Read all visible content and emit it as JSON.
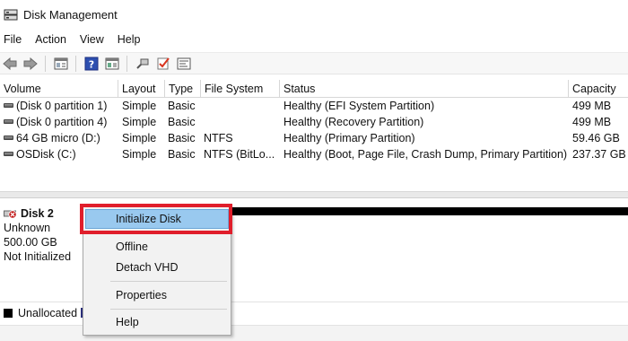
{
  "window": {
    "title": "Disk Management"
  },
  "menu": [
    "File",
    "Action",
    "View",
    "Help"
  ],
  "toolbar": {
    "buttons": [
      "back-arrow-icon",
      "forward-arrow-icon",
      "properties-panel-icon",
      "help-icon",
      "show-hide-pane-icon",
      "connect-icon",
      "checkmark-icon",
      "console-icon"
    ]
  },
  "table": {
    "columns": [
      "Volume",
      "Layout",
      "Type",
      "File System",
      "Status",
      "Capacity"
    ],
    "rows": [
      {
        "volume": "(Disk 0 partition 1)",
        "layout": "Simple",
        "type": "Basic",
        "fs": "",
        "status": "Healthy (EFI System Partition)",
        "capacity": "499 MB"
      },
      {
        "volume": "(Disk 0 partition 4)",
        "layout": "Simple",
        "type": "Basic",
        "fs": "",
        "status": "Healthy (Recovery Partition)",
        "capacity": "499 MB"
      },
      {
        "volume": "64 GB micro (D:)",
        "layout": "Simple",
        "type": "Basic",
        "fs": "NTFS",
        "status": "Healthy (Primary Partition)",
        "capacity": "59.46 GB"
      },
      {
        "volume": "OSDisk (C:)",
        "layout": "Simple",
        "type": "Basic",
        "fs": "NTFS (BitLo...",
        "status": "Healthy (Boot, Page File, Crash Dump, Primary Partition)",
        "capacity": "237.37 GB"
      }
    ]
  },
  "disk": {
    "name": "Disk 2",
    "kind": "Unknown",
    "size": "500.00 GB",
    "state": "Not Initialized"
  },
  "context_menu": {
    "items": [
      "Initialize Disk",
      "Offline",
      "Detach VHD",
      "Properties",
      "Help"
    ],
    "highlighted": "Initialize Disk",
    "highlight_color": "#99c9ef",
    "callout_color": "#e01e2b"
  },
  "legend": {
    "unallocated": "Unallocated"
  }
}
